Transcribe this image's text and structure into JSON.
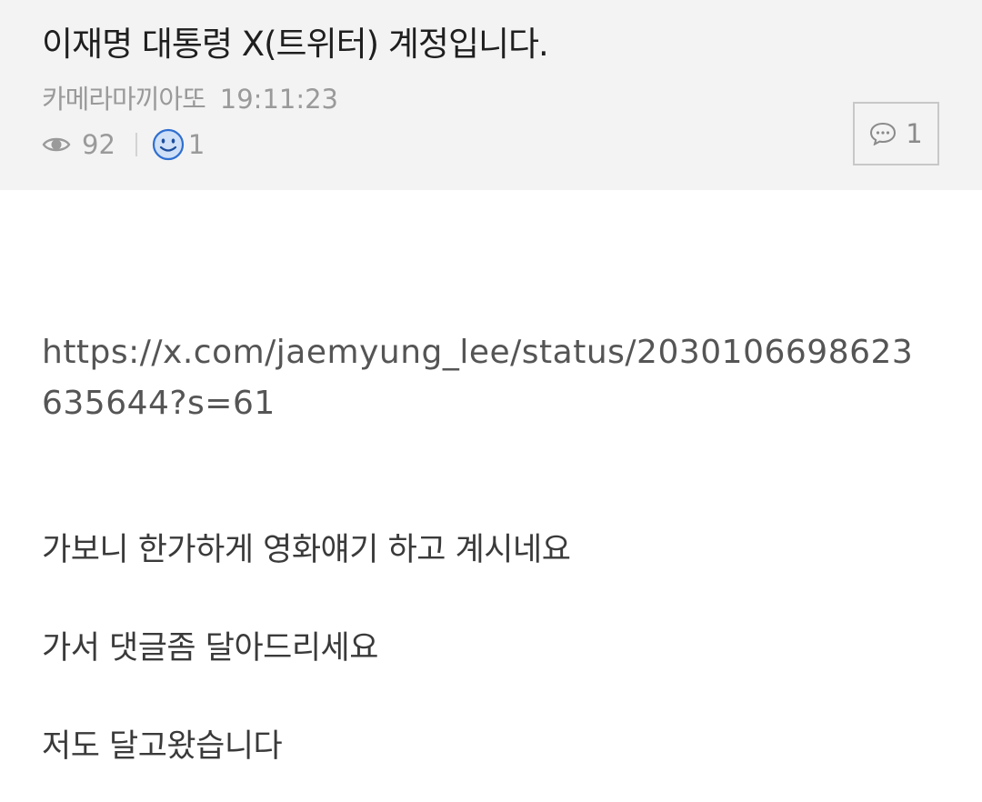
{
  "post": {
    "title": "이재명 대통령 X(트위터) 계정입니다.",
    "author": "카메라마끼아또",
    "time": "19:11:23",
    "views": "92",
    "likes": "1",
    "comments": "1"
  },
  "icons": {
    "views": "eye-icon",
    "likes": "smile-icon",
    "comments": "speech-bubble-icon"
  },
  "colors": {
    "header_bg": "#f3f3f3",
    "smile_blue": "#2f6fd0"
  },
  "body": {
    "link": "https://x.com/jaemyung_lee/status/2030106698623635644?s=61",
    "paragraphs": [
      "가보니 한가하게 영화얘기 하고 계시네요",
      "가서 댓글좀 달아드리세요",
      "저도 달고왔습니다"
    ]
  }
}
